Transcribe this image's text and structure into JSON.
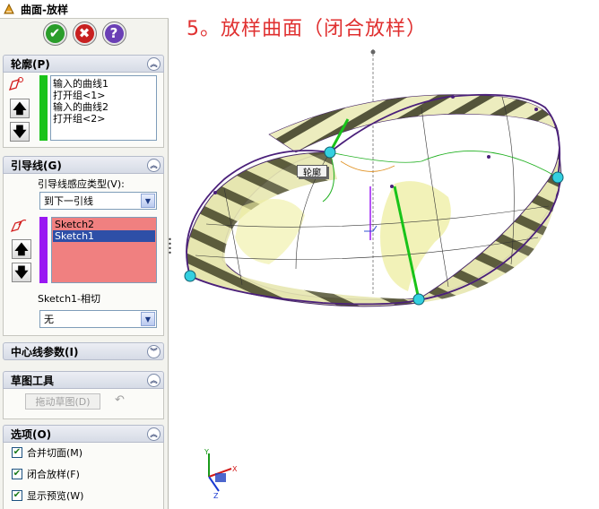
{
  "title": "曲面-放样",
  "actions": {
    "ok": "✔",
    "cancel": "✖",
    "help": "?"
  },
  "profiles": {
    "header": "轮廓(P)",
    "items": [
      "输入的曲线1",
      "打开组<1>",
      "输入的曲线2",
      "打开组<2>"
    ]
  },
  "guides": {
    "header": "引导线(G)",
    "influence_label": "引导线感应类型(V):",
    "influence_value": "到下一引线",
    "items": [
      "Sketch2",
      "Sketch1"
    ],
    "selected_index": 1,
    "tangency_label": "Sketch1-相切",
    "tangency_value": "无"
  },
  "centerline": {
    "header": "中心线参数(I)"
  },
  "sketch_tools": {
    "header": "草图工具",
    "drag_button": "拖动草图(D)"
  },
  "options": {
    "header": "选项(O)",
    "items": [
      {
        "label": "合并切面(M)",
        "checked": true
      },
      {
        "label": "闭合放样(F)",
        "checked": true
      },
      {
        "label": "显示预览(W)",
        "checked": true
      }
    ]
  },
  "viewport": {
    "caption": "5。放样曲面（闭合放样）",
    "callout": "轮廓",
    "triad_axes": {
      "x": "X",
      "y": "Y",
      "z": "Z"
    }
  },
  "colors": {
    "accent_green": "#19c319",
    "accent_purple": "#9a18f2",
    "guide_list_bg": "#f08080",
    "selection": "#2e4fa7",
    "caption_red": "#e03030"
  }
}
